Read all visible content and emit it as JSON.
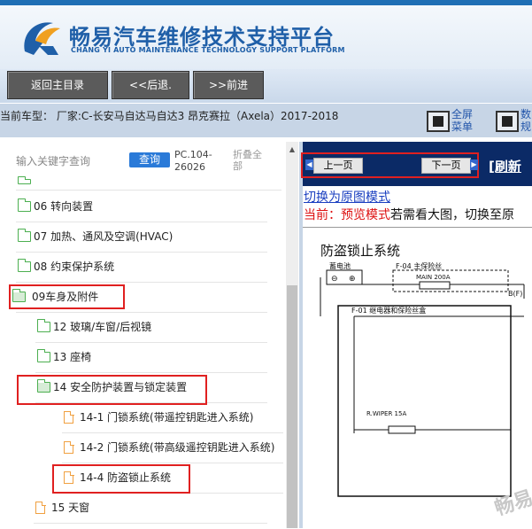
{
  "header": {
    "title": "畅易汽车维修技术支持平台",
    "subtitle": "CHANG YI AUTO MAINTENANCE TECHNOLOGY SUPPORT PLATFORM",
    "colors": {
      "brand_blue": "#1f5fa8",
      "accent_orange": "#f0a020"
    }
  },
  "nav": {
    "home_label": "返回主目录",
    "back_label": "<<后退.",
    "forward_label": ">>前进"
  },
  "vehicle": {
    "text": "当前车型：  厂家:C-长安马自达马自达3 昂克赛拉（Axela）2017-2018",
    "fullscreen_label_1": "全屏",
    "fullscreen_label_2": "菜单",
    "right_label_1": "数",
    "right_label_2": "规"
  },
  "search": {
    "placeholder": "输入关键字查询",
    "query_button": "查询",
    "pc_number": "PC.104-26026",
    "fold_all": "折叠全部"
  },
  "tree": {
    "items": [
      {
        "label": "06 转向装置",
        "icon": "folder-icon"
      },
      {
        "label": "07 加热、通风及空调(HVAC)",
        "icon": "folder-icon"
      },
      {
        "label": "08 约束保护系统",
        "icon": "folder-icon"
      },
      {
        "label": "09车身及附件",
        "icon": "folder-open-icon"
      },
      {
        "label": "12 玻璃/车窗/后视镜",
        "icon": "folder-icon"
      },
      {
        "label": "13 座椅",
        "icon": "folder-icon"
      },
      {
        "label": "14 安全防护装置与锁定装置",
        "icon": "folder-open-icon"
      },
      {
        "label": "14-1 门锁系统(带遥控钥匙进入系统)",
        "icon": "document-icon"
      },
      {
        "label": "14-2 门锁系统(带高级遥控钥匙进入系统)",
        "icon": "document-icon"
      },
      {
        "label": "14-4 防盗锁止系统",
        "icon": "document-icon"
      },
      {
        "label": "15 天窗",
        "icon": "document-icon"
      }
    ]
  },
  "viewer": {
    "prev_page": "上一页",
    "next_page": "下一页",
    "refresh_label": "[刷新",
    "switch_link": "切换为原图模式",
    "current_prefix": "当前：预览模式",
    "current_suffix": "若需看大图，切换至原",
    "diagram": {
      "title": "防盗锁止系统",
      "battery": "蓄电池",
      "fuse_box": "F-04 主保险丝",
      "main_fuse": "MAIN 200A",
      "relay_box": "F-01 继电器和保险丝盒",
      "connector": "B(F)",
      "wiper_fuse": "R.WIPER 15A"
    },
    "watermark": "畅易"
  }
}
